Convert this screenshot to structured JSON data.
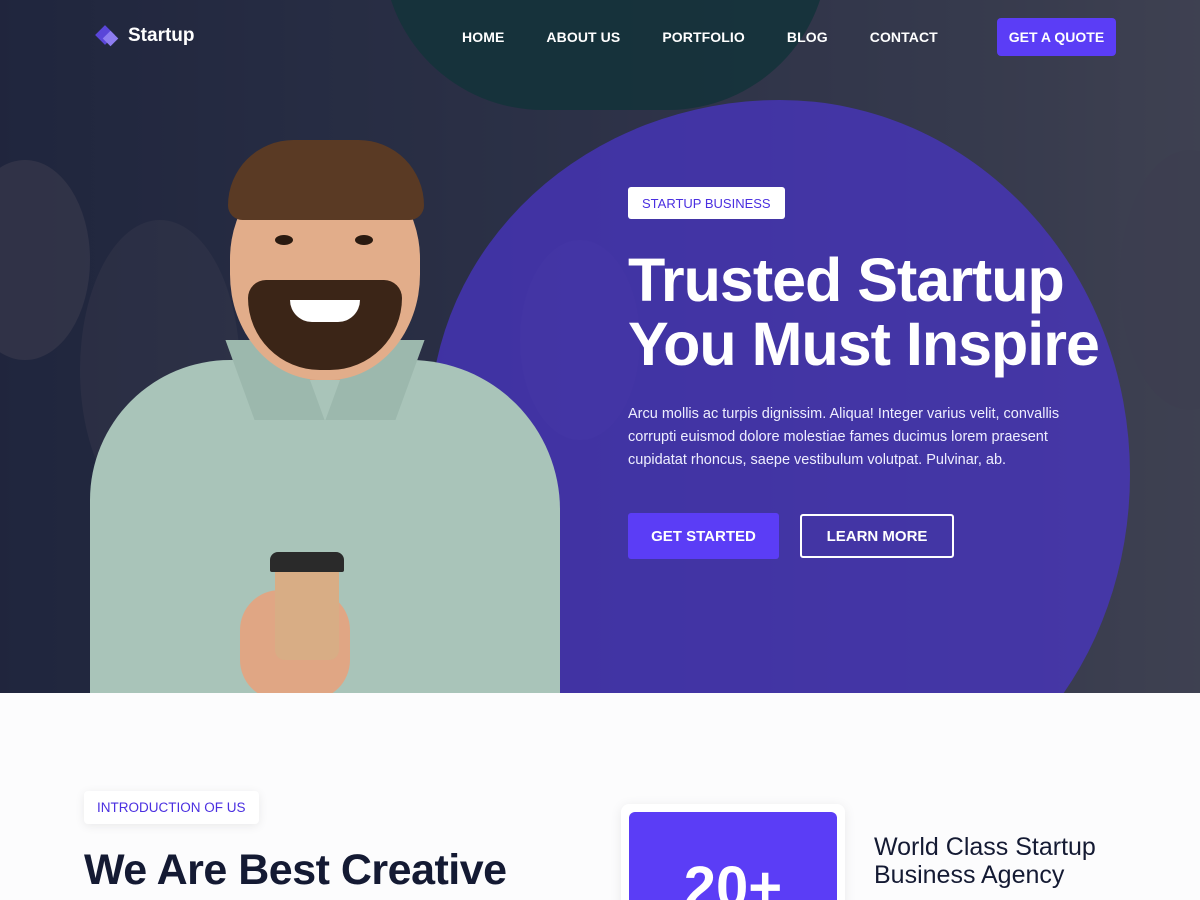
{
  "header": {
    "logo_text": "Startup",
    "nav": [
      "HOME",
      "ABOUT US",
      "PORTFOLIO",
      "BLOG",
      "CONTACT"
    ],
    "quote_button": "GET A QUOTE"
  },
  "hero": {
    "badge": "STARTUP BUSINESS",
    "title_line1": "Trusted Startup",
    "title_line2": "You Must Inspire",
    "description": "Arcu mollis ac turpis dignissim. Aliqua! Integer varius velit, convallis corrupti euismod dolore molestiae fames ducimus lorem praesent cupidatat rhoncus, saepe vestibulum volutpat. Pulvinar, ab.",
    "primary_button": "GET STARTED",
    "secondary_button": "LEARN MORE"
  },
  "intro": {
    "badge": "INTRODUCTION OF US",
    "title": "We Are Best Creative",
    "stat_number": "20+",
    "agency_title": "World Class Startup Business Agency"
  },
  "colors": {
    "accent": "#5b3df6",
    "dark_text": "#141a33"
  },
  "icons": {
    "logo": "diamond-logo-icon"
  }
}
